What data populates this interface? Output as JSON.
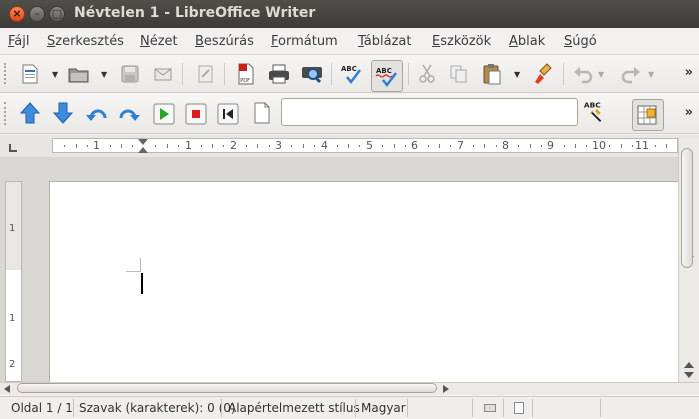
{
  "window": {
    "title": "Névtelen 1 - LibreOffice Writer",
    "controls": {
      "close": "×",
      "minimize": "–",
      "maximize": "□"
    }
  },
  "menu": [
    {
      "label": "Fájl",
      "mnemonic": "F",
      "rest": "ájl"
    },
    {
      "label": "Szerkesztés",
      "mnemonic": "S",
      "rest": "zerkesztés"
    },
    {
      "label": "Nézet",
      "mnemonic": "N",
      "rest": "ézet"
    },
    {
      "label": "Beszúrás",
      "mnemonic": "B",
      "rest": "eszúrás"
    },
    {
      "label": "Formátum",
      "mnemonic": "F",
      "rest": "ormátum"
    },
    {
      "label": "Táblázat",
      "mnemonic": "T",
      "rest": "áblázat"
    },
    {
      "label": "Eszközök",
      "mnemonic": "E",
      "rest": "szközök"
    },
    {
      "label": "Ablak",
      "mnemonic": "A",
      "rest": "blak"
    },
    {
      "label": "Súgó",
      "mnemonic": "S",
      "rest": "úgó"
    }
  ],
  "toolbar1": {
    "icons": [
      "new-document-icon",
      "open-folder-icon",
      "save-icon",
      "email-icon",
      "edit-file-icon",
      "export-pdf-icon",
      "print-icon",
      "print-preview-icon",
      "spellcheck-icon",
      "autospellcheck-icon",
      "cut-icon",
      "copy-icon",
      "paste-icon",
      "clone-format-icon",
      "undo-icon",
      "redo-icon"
    ],
    "more": "»"
  },
  "toolbar2": {
    "icons": [
      "arrow-up-icon",
      "arrow-down-icon",
      "rotate-left-icon",
      "rotate-right-icon",
      "play-icon",
      "stop-icon",
      "rewind-icon",
      "blank-page-icon",
      "find-replace-icon",
      "table-grid-icon"
    ],
    "find_value": "",
    "more": "»",
    "spell_label": "ABC"
  },
  "spell_label": "ABC",
  "pdf_label": "PDF",
  "ruler": {
    "numbers": [
      "1",
      "1",
      "2",
      "3",
      "4",
      "5",
      "6",
      "7",
      "8",
      "9",
      "10",
      "11"
    ],
    "vertical_numbers": [
      "1",
      "1",
      "2"
    ]
  },
  "colors": {
    "titlebar": "#3c3b37",
    "close_button": "#df4a16",
    "accent_blue": "#2f7fd4",
    "play_green": "#2aa32a",
    "stop_red": "#d81e1e"
  },
  "status": {
    "page": "Oldal 1 / 1",
    "words": "Szavak (karakterek): 0 (0)",
    "style": "Alapértelmezett stílus",
    "language": "Magyar"
  }
}
